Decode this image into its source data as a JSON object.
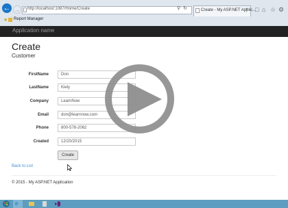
{
  "browser": {
    "url": "http://localhost:1087/Home/Create",
    "tab_title": "Create - My ASP.NET Applic...",
    "tab_close": "×",
    "favorites_item": "Report Manager"
  },
  "navbar": {
    "brand": "Application name"
  },
  "page": {
    "title": "Create",
    "subtitle": "Customer",
    "fields": [
      {
        "label": "FirstName",
        "value": "Don"
      },
      {
        "label": "LastName",
        "value": "Kiely"
      },
      {
        "label": "Company",
        "value": "LearnNow"
      },
      {
        "label": "Email",
        "value": "don@learnnow.com"
      },
      {
        "label": "Phone",
        "value": "800-578-2062"
      },
      {
        "label": "Created",
        "value": "12/20/2015"
      }
    ],
    "submit_label": "Create",
    "back_link": "Back to List",
    "footer": "© 2015 - My ASP.NET Application"
  },
  "colors": {
    "navbar_bg": "#222222",
    "link": "#428bca",
    "taskbar": "#5d9ec0",
    "play_overlay": "#8e8e8e"
  }
}
